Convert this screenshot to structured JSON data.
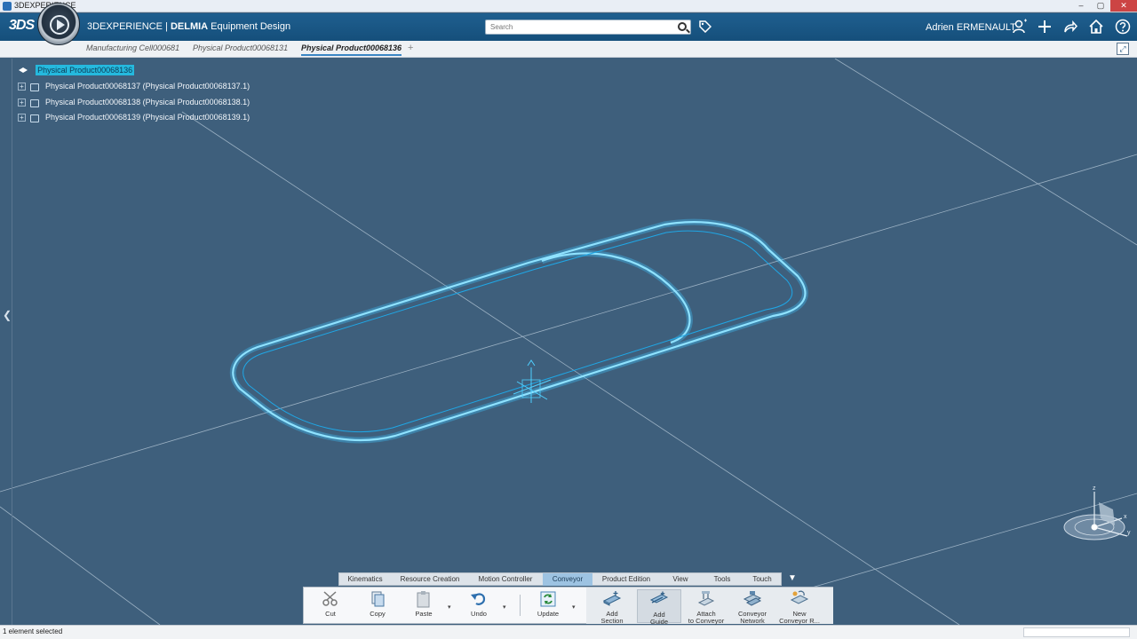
{
  "window": {
    "title": "3DEXPERIENCE",
    "controls": [
      "–",
      "▢",
      "✕"
    ]
  },
  "header": {
    "logo": "3DS",
    "app_brand": "3DEXPERIENCE | ",
    "app_brand_bold": "DELMIA",
    "app_name": " Equipment Design",
    "search_placeholder": "Search",
    "user_name": "Adrien ERMENAULT",
    "icons": [
      "user-icon",
      "plus-icon",
      "share-icon",
      "home-icon",
      "help-icon"
    ],
    "accent_color": "#1b5a88"
  },
  "tabs": [
    {
      "label": "Manufacturing Cell000681",
      "active": false
    },
    {
      "label": "Physical Product00068131",
      "active": false
    },
    {
      "label": "Physical Product00068136",
      "active": true
    }
  ],
  "tree": {
    "root_label": "Physical Product00068136",
    "items": [
      {
        "label": "Physical Product00068137 (Physical Product00068137.1)"
      },
      {
        "label": "Physical Product00068138 (Physical Product00068138.1)"
      },
      {
        "label": "Physical Product00068139 (Physical Product00068139.1)"
      }
    ]
  },
  "axis_labels": {
    "z": "z",
    "x": "x",
    "y": "y"
  },
  "action_tabs": [
    {
      "label": "Kinematics",
      "active": false
    },
    {
      "label": "Resource Creation",
      "active": false
    },
    {
      "label": "Motion Controller",
      "active": false
    },
    {
      "label": "Conveyor",
      "active": true
    },
    {
      "label": "Product Edition",
      "active": false
    },
    {
      "label": "View",
      "active": false
    },
    {
      "label": "Tools",
      "active": false
    },
    {
      "label": "Touch",
      "active": false
    }
  ],
  "actions": {
    "cut": "Cut",
    "copy": "Copy",
    "paste": "Paste",
    "undo": "Undo",
    "update": "Update",
    "add_section_1": "Add",
    "add_section_2": "Section",
    "add_guide_1": "Add",
    "add_guide_2": "Guide",
    "attach_1": "Attach",
    "attach_2": "to Conveyor",
    "network_1": "Conveyor",
    "network_2": "Network",
    "new_1": "New",
    "new_2": "Conveyor R..."
  },
  "status": {
    "text": "1 element selected"
  },
  "colors": {
    "viewport_bg": "#3e5f7c",
    "conveyor": "#3fc6ff",
    "selection": "#25b9de"
  }
}
